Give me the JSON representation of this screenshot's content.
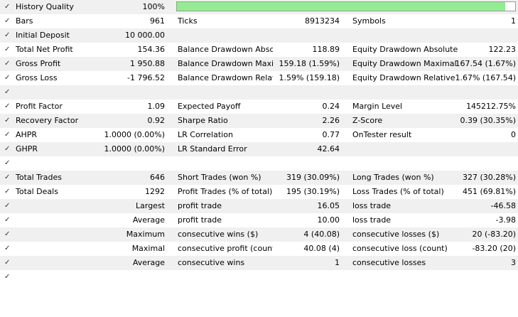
{
  "check_glyph": "✓",
  "history_quality": {
    "label": "History Quality",
    "value": "100%",
    "fill_fraction": 0.97,
    "bar_color": "#90ee90"
  },
  "stats": [
    {
      "id": "bars",
      "c1": [
        "Bars",
        "961"
      ],
      "c2": [
        "Ticks",
        "8913234"
      ],
      "c3": [
        "Symbols",
        "1"
      ]
    },
    {
      "id": "initial-deposit",
      "c1": [
        "Initial Deposit",
        "10 000.00"
      ]
    },
    {
      "id": "total-net-profit",
      "c1": [
        "Total Net Profit",
        "154.36"
      ],
      "c2": [
        "Balance Drawdown Absol...",
        "118.89"
      ],
      "c3": [
        "Equity Drawdown Absolute",
        "122.23"
      ]
    },
    {
      "id": "gross-profit",
      "c1": [
        "Gross Profit",
        "1 950.88"
      ],
      "c2": [
        "Balance Drawdown Maxi...",
        "159.18 (1.59%)"
      ],
      "c3": [
        "Equity Drawdown Maximal",
        "167.54 (1.67%)"
      ]
    },
    {
      "id": "gross-loss",
      "c1": [
        "Gross Loss",
        "-1 796.52"
      ],
      "c2": [
        "Balance Drawdown Relati...",
        "1.59% (159.18)"
      ],
      "c3": [
        "Equity Drawdown Relative",
        "1.67% (167.54)"
      ]
    },
    {
      "id": "blank-1"
    },
    {
      "id": "profit-factor",
      "c1": [
        "Profit Factor",
        "1.09"
      ],
      "c2": [
        "Expected Payoff",
        "0.24"
      ],
      "c3": [
        "Margin Level",
        "145212.75%"
      ]
    },
    {
      "id": "recovery-factor",
      "c1": [
        "Recovery Factor",
        "0.92"
      ],
      "c2": [
        "Sharpe Ratio",
        "2.26"
      ],
      "c3": [
        "Z-Score",
        "0.39 (30.35%)"
      ]
    },
    {
      "id": "ahpr",
      "c1": [
        "AHPR",
        "1.0000 (0.00%)"
      ],
      "c2": [
        "LR Correlation",
        "0.77"
      ],
      "c3": [
        "OnTester result",
        "0"
      ]
    },
    {
      "id": "ghpr",
      "c1": [
        "GHPR",
        "1.0000 (0.00%)"
      ],
      "c2": [
        "LR Standard Error",
        "42.64"
      ]
    },
    {
      "id": "blank-2"
    },
    {
      "id": "total-trades",
      "c1": [
        "Total Trades",
        "646"
      ],
      "c2": [
        "Short Trades (won %)",
        "319 (30.09%)"
      ],
      "c3": [
        "Long Trades (won %)",
        "327 (30.28%)"
      ]
    },
    {
      "id": "total-deals",
      "c1": [
        "Total Deals",
        "1292"
      ],
      "c2": [
        "Profit Trades (% of total)",
        "195 (30.19%)"
      ],
      "c3": [
        "Loss Trades (% of total)",
        "451 (69.81%)"
      ]
    },
    {
      "id": "largest",
      "sub": "Largest",
      "c2": [
        "profit trade",
        "16.05"
      ],
      "c3": [
        "loss trade",
        "-46.58"
      ]
    },
    {
      "id": "average",
      "sub": "Average",
      "c2": [
        "profit trade",
        "10.00"
      ],
      "c3": [
        "loss trade",
        "-3.98"
      ]
    },
    {
      "id": "maximum",
      "sub": "Maximum",
      "c2": [
        "consecutive wins ($)",
        "4 (40.08)"
      ],
      "c3": [
        "consecutive losses ($)",
        "20 (-83.20)"
      ]
    },
    {
      "id": "maximal",
      "sub": "Maximal",
      "c2": [
        "consecutive profit (count)",
        "40.08 (4)"
      ],
      "c3": [
        "consecutive loss (count)",
        "-83.20 (20)"
      ]
    },
    {
      "id": "average-consecutive",
      "sub": "Average",
      "c2": [
        "consecutive wins",
        "1"
      ],
      "c3": [
        "consecutive losses",
        "3"
      ]
    },
    {
      "id": "blank-3"
    }
  ]
}
